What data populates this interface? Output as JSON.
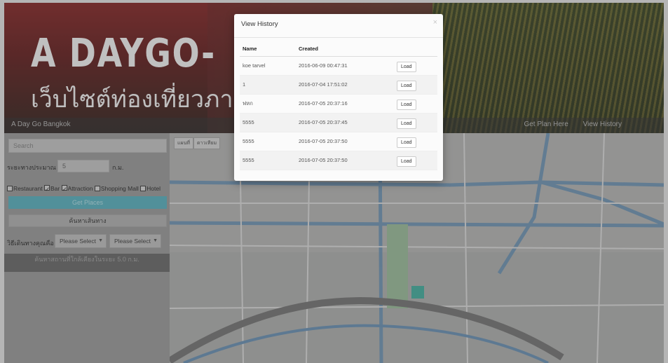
{
  "header": {
    "brand": "A  DAYGO-",
    "subtitle": "เว็บไซต์ท่องเที่ยวภายใน",
    "nav_left": "A Day Go Bangkok",
    "nav_right": [
      "Get Plan Here",
      "View History"
    ]
  },
  "sidebar": {
    "search_placeholder": "Search",
    "distance_label": "ระยะทางประมาณ",
    "distance_value": "5",
    "distance_unit": "ก.ม.",
    "categories": [
      "Restaurant",
      "Bar",
      "Attraction",
      "Shopping Mall",
      "Hotel"
    ],
    "checked": [
      false,
      true,
      true,
      false,
      false
    ],
    "search_button": "Get Places",
    "route_button": "ค้นหาเส้นทาง",
    "travel_label": "วิธีเดินทางคุณคือ",
    "select1": "Please Select",
    "select2": "Please Select",
    "banner": "ค้นหาสถานที่ใกล้เคียงในระยะ 5.0 ก.ม."
  },
  "map": {
    "buttons": [
      "แผนที่",
      "ดาวเทียม"
    ]
  },
  "modal": {
    "title": "View History",
    "close": "×",
    "columns": [
      "Name",
      "Created"
    ],
    "load_label": "Load",
    "rows": [
      {
        "name": "koe tarvel",
        "created": "2016-06-09 00:47:31"
      },
      {
        "name": "1",
        "created": "2016-07-04 17:51:02"
      },
      {
        "name": "ฟหก",
        "created": "2016-07-05 20:37:16"
      },
      {
        "name": "5555",
        "created": "2016-07-05 20:37:45"
      },
      {
        "name": "5555",
        "created": "2016-07-05 20:37:50"
      },
      {
        "name": "5555",
        "created": "2016-07-05 20:37:50"
      }
    ]
  },
  "colors": {
    "accent": "#4ea5b3",
    "header_red": "#7a1d1d"
  }
}
